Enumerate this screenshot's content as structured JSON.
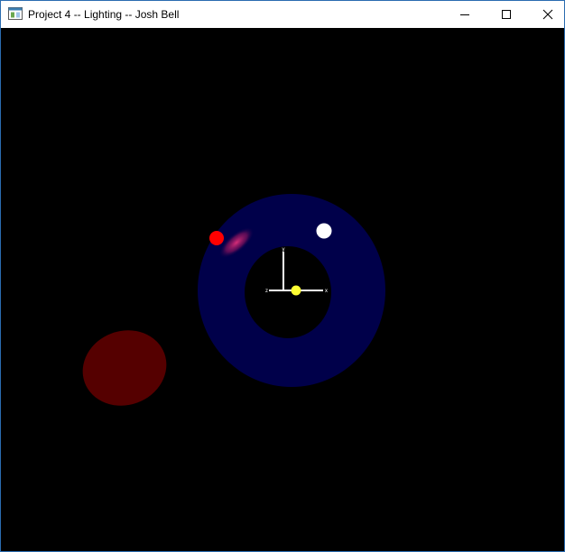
{
  "window": {
    "title": "Project 4 -- Lighting -- Josh Bell",
    "icon": "app-window-icon",
    "controls": {
      "minimize": "minimize-icon",
      "maximize": "maximize-icon",
      "close": "close-icon"
    }
  },
  "scene": {
    "background": "#000000",
    "torus_color": "#00004a",
    "highlight_color": "#c01660",
    "sphere_color": "#550000",
    "light_colors": {
      "red": "#ff0000",
      "white": "#ffffff",
      "yellow": "#ffff33"
    },
    "axes": {
      "x_label": "x",
      "y_label": "y",
      "z_label": "z"
    }
  }
}
